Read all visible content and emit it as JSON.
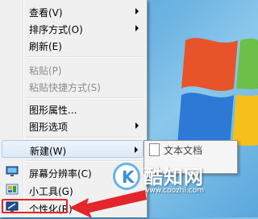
{
  "menu": {
    "items": [
      {
        "label": "查看(V)"
      },
      {
        "label": "排序方式(O)"
      },
      {
        "label": "刷新(E)"
      },
      {
        "label": "粘贴(P)"
      },
      {
        "label": "粘贴快捷方式(S)"
      },
      {
        "label": "图形属性..."
      },
      {
        "label": "图形选项"
      },
      {
        "label": "新建(W)"
      },
      {
        "label": "屏幕分辨率(C)"
      },
      {
        "label": "小工具(G)"
      },
      {
        "label": "个性化(R)"
      }
    ]
  },
  "submenu": {
    "first_item": "文本文档"
  },
  "watermark": {
    "logo_letter": "K",
    "name": "酷知网",
    "url": "www.coozhi.com"
  },
  "icons": [
    "screen-resolution-icon",
    "gadgets-icon",
    "personalize-icon",
    "text-document-icon",
    "chevron-right-icon"
  ],
  "colors": {
    "menu_bg": "#f0f0f0",
    "highlight": "#dde9f7",
    "annotation_red": "#e3262b",
    "disabled_text": "#8d8d8d"
  }
}
